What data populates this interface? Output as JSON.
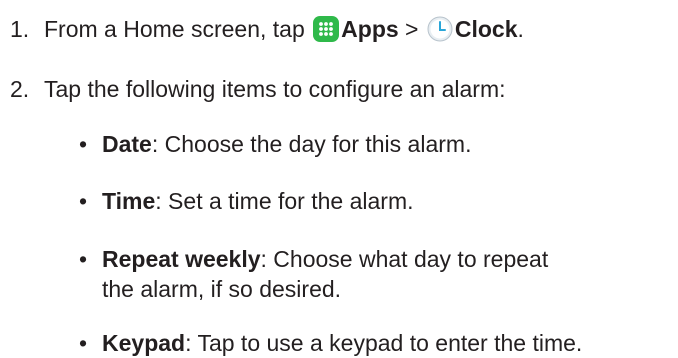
{
  "steps": [
    {
      "number": "1.",
      "prefix": "From a Home screen, tap",
      "apps_label": "Apps",
      "separator": ">",
      "clock_label": "Clock",
      "suffix": "."
    },
    {
      "number": "2.",
      "text": "Tap the following items to configure an alarm:"
    }
  ],
  "items": [
    {
      "term": "Date",
      "desc": ": Choose the day for this alarm."
    },
    {
      "term": "Time",
      "desc": ": Set a time for the alarm."
    },
    {
      "term": "Repeat weekly",
      "desc": ": Choose what day to repeat",
      "desc_line2": "the alarm, if so desired."
    },
    {
      "term": "Keypad",
      "desc": ": Tap to use a keypad to enter the time."
    }
  ],
  "bullet_glyph": "•",
  "icons": {
    "apps": "apps-grid-icon",
    "clock": "clock-icon"
  },
  "colors": {
    "text": "#231f20",
    "apps_icon_bg": "#2fb94a",
    "clock_face": "#e8eef2"
  }
}
